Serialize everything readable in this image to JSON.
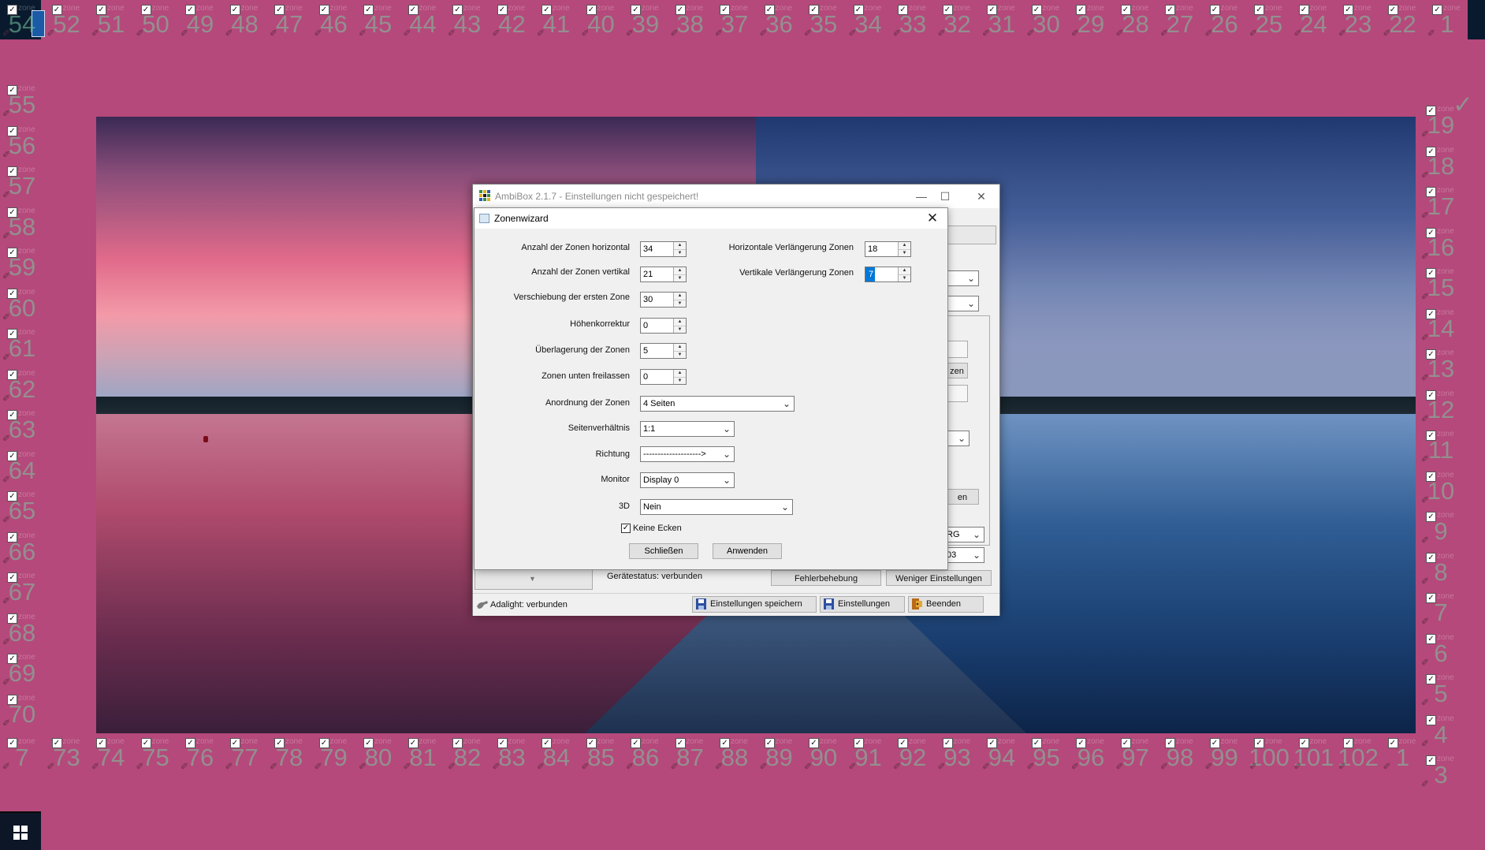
{
  "frame": {
    "top_numbers": [
      "54",
      "52",
      "51",
      "50",
      "49",
      "48",
      "47",
      "46",
      "45",
      "44",
      "43",
      "42",
      "41",
      "40",
      "39",
      "38",
      "37",
      "36",
      "35",
      "34",
      "33",
      "32",
      "31",
      "30",
      "29",
      "28",
      "27",
      "26",
      "25",
      "24",
      "23",
      "22",
      "1"
    ],
    "bottom_numbers": [
      "7",
      "73",
      "74",
      "75",
      "76",
      "77",
      "78",
      "79",
      "80",
      "81",
      "82",
      "83",
      "84",
      "85",
      "86",
      "87",
      "88",
      "89",
      "90",
      "91",
      "92",
      "93",
      "94",
      "95",
      "96",
      "97",
      "98",
      "99",
      "100",
      "101",
      "102",
      "1"
    ],
    "left_numbers": [
      "55",
      "56",
      "57",
      "58",
      "59",
      "60",
      "61",
      "62",
      "63",
      "64",
      "65",
      "66",
      "67",
      "68",
      "69",
      "70"
    ],
    "right_numbers": [
      "19",
      "18",
      "17",
      "16",
      "15",
      "14",
      "13",
      "12",
      "11",
      "10",
      "9",
      "8",
      "7",
      "6",
      "5",
      "4",
      "3"
    ],
    "top_right_symbol": "✓",
    "cell_tag": "zone",
    "checkbox_mark": "✓",
    "brush_mark": "✐"
  },
  "main_window": {
    "title": "AmbiBox 2.1.7  - Einstellungen nicht gespeichert!",
    "minimize": "—",
    "maximize": "☐",
    "close": "✕",
    "behind": {
      "btn_fragment_1": "zen",
      "btn_fragment_2": "en",
      "select_fragment_1": "RG",
      "select_fragment_2": "03"
    },
    "device_status": "Gerätestatus: verbunden",
    "troubleshoot_button": "Fehlerbehebung",
    "less_settings_button": "Weniger Einstellungen",
    "statusbar": {
      "adalight_status": "Adalight: verbunden",
      "save_button": "Einstellungen speichern",
      "settings_button": "Einstellungen",
      "exit_button": "Beenden"
    }
  },
  "wizard": {
    "title": "Zonenwizard",
    "close": "✕",
    "fields": {
      "zones_horizontal": {
        "label": "Anzahl der Zonen horizontal",
        "value": "34"
      },
      "zones_vertical": {
        "label": "Anzahl der Zonen vertikal",
        "value": "21"
      },
      "first_zone_offset": {
        "label": "Verschiebung der ersten Zone",
        "value": "30"
      },
      "height_correction": {
        "label": "Höhenkorrektur",
        "value": "0"
      },
      "zone_overlap": {
        "label": "Überlagerung der Zonen",
        "value": "5"
      },
      "bottom_free": {
        "label": "Zonen unten freilassen",
        "value": "0"
      },
      "horizontal_extension": {
        "label": "Horizontale Verlängerung Zonen",
        "value": "18"
      },
      "vertical_extension": {
        "label": "Vertikale Verlängerung Zonen",
        "value": "7"
      }
    },
    "selects": {
      "arrangement": {
        "label": "Anordnung der Zonen",
        "value": "4 Seiten"
      },
      "aspect_ratio": {
        "label": "Seitenverhältnis",
        "value": "1:1"
      },
      "direction": {
        "label": "Richtung",
        "value": "-------------------->"
      },
      "monitor": {
        "label": "Monitor",
        "value": "Display 0"
      },
      "three_d": {
        "label": "3D",
        "value": "Nein"
      }
    },
    "no_corners": {
      "label": "Keine Ecken",
      "checked": true
    },
    "close_button": "Schließen",
    "apply_button": "Anwenden"
  },
  "colors": {
    "frame_background": "#b5497b",
    "focus_blue": "#0078d7"
  }
}
